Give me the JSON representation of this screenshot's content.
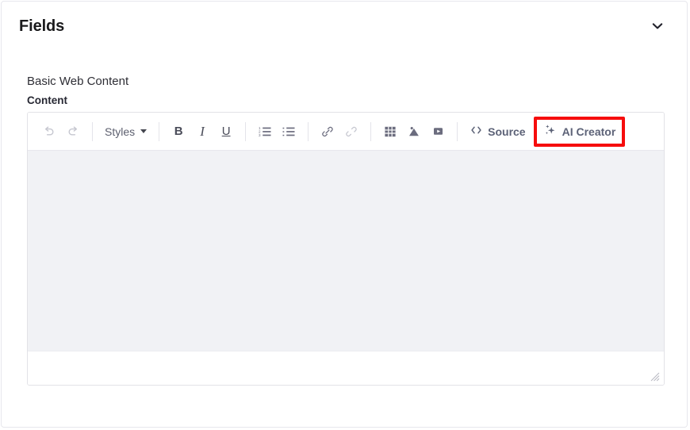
{
  "panel": {
    "title": "Fields",
    "collapse_icon": "chevron-down-icon"
  },
  "field_group": {
    "label": "Basic Web Content",
    "field_label": "Content"
  },
  "editor": {
    "toolbar": {
      "undo": {
        "label": "Undo",
        "icon": "undo-icon",
        "disabled": true
      },
      "redo": {
        "label": "Redo",
        "icon": "redo-icon",
        "disabled": true
      },
      "styles": {
        "label": "Styles",
        "icon": "chevron-down-icon"
      },
      "bold": {
        "label": "B",
        "icon": "bold-icon"
      },
      "italic": {
        "label": "I",
        "icon": "italic-icon"
      },
      "underline": {
        "label": "U",
        "icon": "underline-icon"
      },
      "numbered_list": {
        "label": "Numbered List",
        "icon": "numbered-list-icon"
      },
      "bulleted_list": {
        "label": "Bulleted List",
        "icon": "bulleted-list-icon"
      },
      "link": {
        "label": "Link",
        "icon": "link-icon",
        "disabled": false
      },
      "unlink": {
        "label": "Unlink",
        "icon": "unlink-icon",
        "disabled": true
      },
      "table": {
        "label": "Table",
        "icon": "table-icon"
      },
      "image": {
        "label": "Image",
        "icon": "image-icon"
      },
      "video": {
        "label": "Video",
        "icon": "video-icon"
      },
      "source": {
        "label": "Source",
        "icon": "code-brackets-icon"
      },
      "ai_creator": {
        "label": "AI Creator",
        "icon": "sparkle-icon"
      }
    },
    "content": "",
    "resize_handle": "resize-grip-icon"
  },
  "highlight": {
    "color": "#f60d0d",
    "target": "AI Creator"
  },
  "colors": {
    "panel_border": "#e7e7ed",
    "toolbar_icon": "#6b6c7e",
    "toolbar_icon_disabled": "#c6c7d0",
    "content_bg": "#f1f2f5",
    "title_text": "#1a1a1c"
  }
}
